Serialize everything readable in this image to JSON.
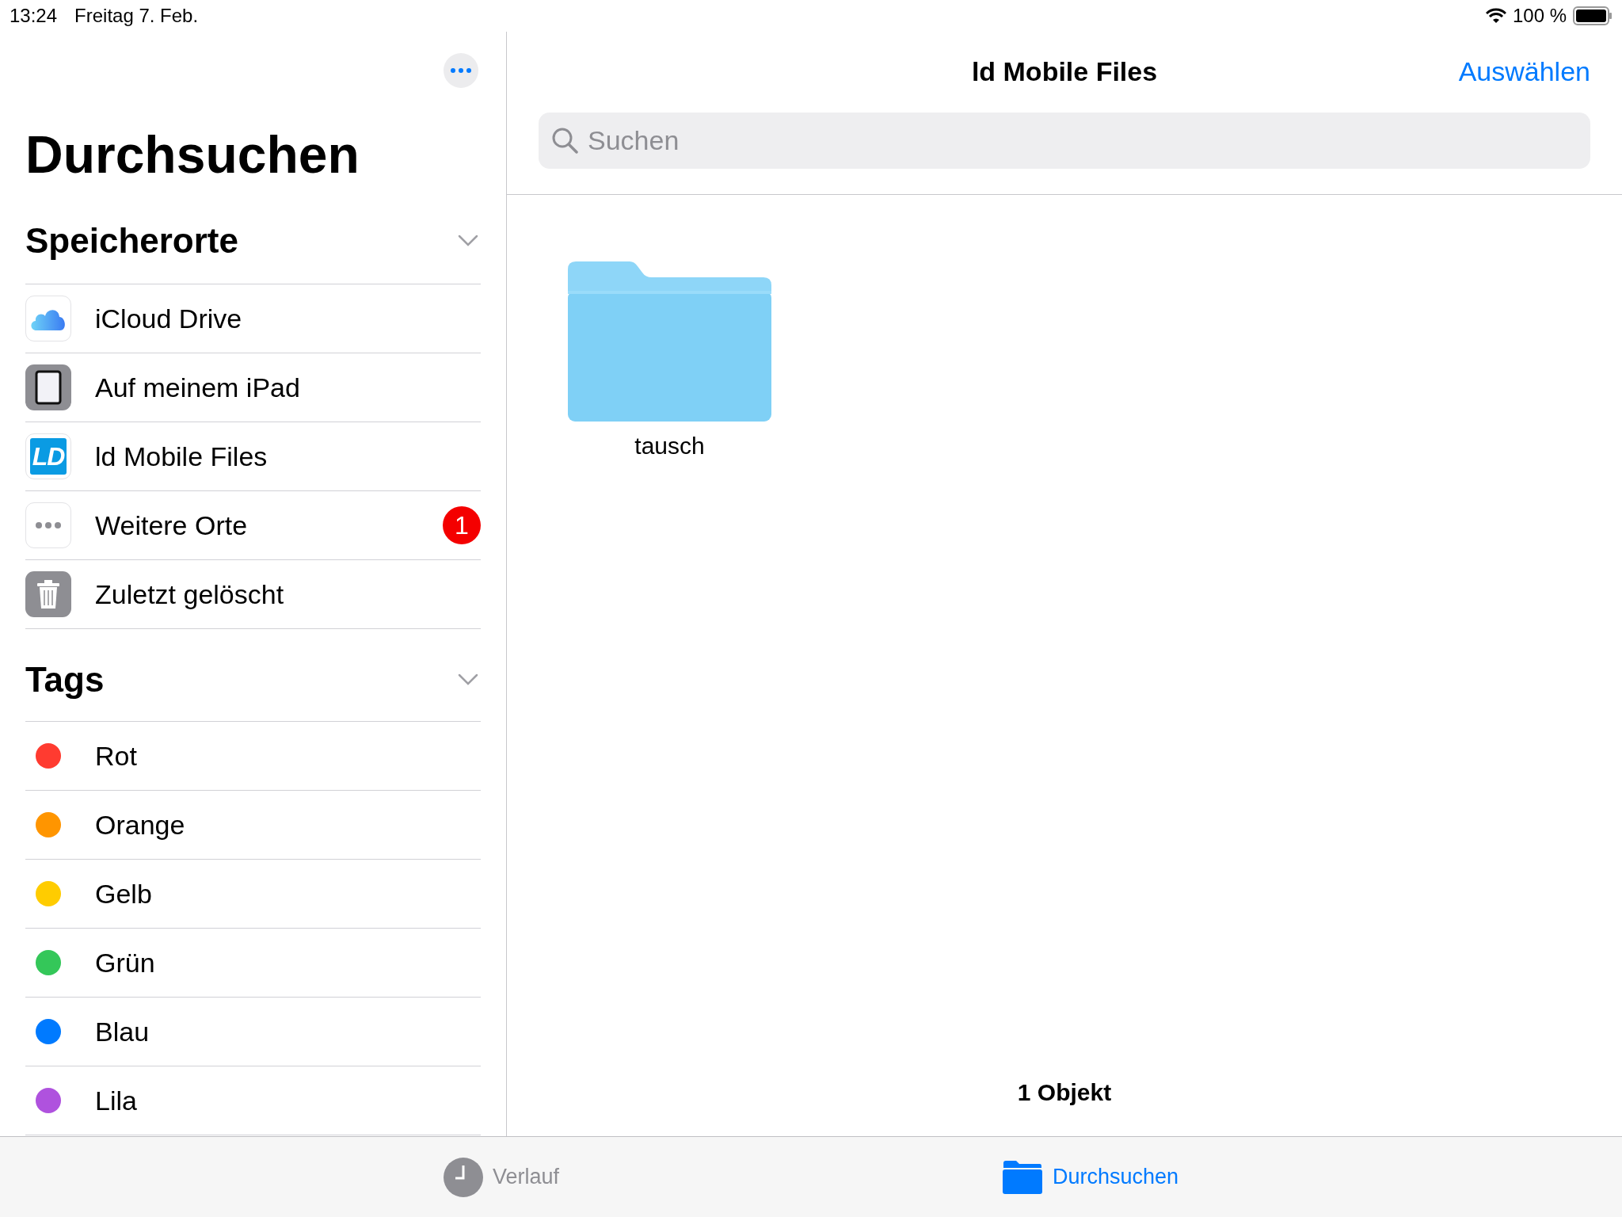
{
  "status_bar": {
    "time": "13:24",
    "date": "Freitag 7. Feb.",
    "battery": "100 %"
  },
  "sidebar": {
    "title": "Durchsuchen",
    "sections": [
      {
        "title": "Speicherorte",
        "expanded": true,
        "items": [
          {
            "label": "iCloud Drive",
            "kind": "cloud"
          },
          {
            "label": "Auf meinem iPad",
            "kind": "ipad"
          },
          {
            "label": "ld Mobile Files",
            "kind": "logo",
            "logo_text": "LD"
          },
          {
            "label": "Weitere Orte",
            "kind": "more",
            "badge": "1"
          },
          {
            "label": "Zuletzt gelöscht",
            "kind": "trash"
          }
        ]
      },
      {
        "title": "Tags",
        "expanded": true,
        "items": [
          {
            "label": "Rot",
            "kind": "tag",
            "color": "#ff3b30"
          },
          {
            "label": "Orange",
            "kind": "tag",
            "color": "#ff9500"
          },
          {
            "label": "Gelb",
            "kind": "tag",
            "color": "#ffcc00"
          },
          {
            "label": "Grün",
            "kind": "tag",
            "color": "#34c759"
          },
          {
            "label": "Blau",
            "kind": "tag",
            "color": "#007aff"
          },
          {
            "label": "Lila",
            "kind": "tag",
            "color": "#af52de"
          }
        ]
      }
    ]
  },
  "main": {
    "title": "ld Mobile Files",
    "action": "Auswählen",
    "search": {
      "placeholder": "Suchen"
    },
    "items": [
      {
        "name": "tausch",
        "kind": "folder"
      }
    ],
    "footer": "1 Objekt"
  },
  "tab_bar": {
    "tabs": [
      {
        "label": "Verlauf",
        "kind": "recents",
        "selected": false
      },
      {
        "label": "Durchsuchen",
        "kind": "browse",
        "selected": true
      }
    ]
  }
}
